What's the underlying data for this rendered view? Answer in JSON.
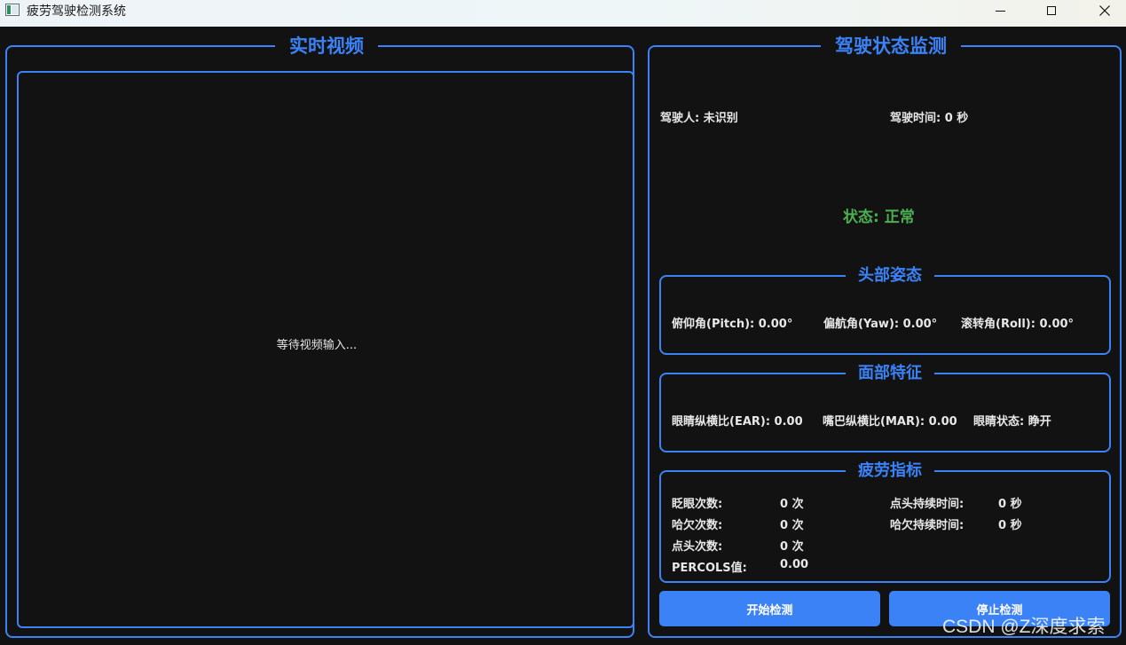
{
  "window": {
    "title": "疲劳驾驶检测系统"
  },
  "video_panel": {
    "title": "实时视频",
    "placeholder": "等待视频输入..."
  },
  "status_panel": {
    "title": "驾驶状态监测",
    "driver": "驾驶人: 未识别",
    "drive_time": "驾驶时间: 0 秒",
    "status": "状态: 正常"
  },
  "head_pose": {
    "title": "头部姿态",
    "pitch": "俯仰角(Pitch): 0.00°",
    "yaw": "偏航角(Yaw): 0.00°",
    "roll": "滚转角(Roll): 0.00°"
  },
  "face_features": {
    "title": "面部特征",
    "ear": "眼睛纵横比(EAR): 0.00",
    "mar": "嘴巴纵横比(MAR): 0.00",
    "eye_state": "眼睛状态: 睁开"
  },
  "fatigue": {
    "title": "疲劳指标",
    "blink_label": "眨眼次数:",
    "blink_value": "0 次",
    "yawn_label": "哈欠次数:",
    "yawn_value": "0 次",
    "nod_label": "点头次数:",
    "nod_value": "0 次",
    "perclos_label": "PERCOLS值:",
    "perclos_value": "0.00",
    "nod_duration_label": "点头持续时间:",
    "nod_duration_value": "0 秒",
    "yawn_duration_label": "哈欠持续时间:",
    "yawn_duration_value": "0 秒"
  },
  "buttons": {
    "start": "开始检测",
    "stop": "停止检测"
  },
  "watermark": "CSDN @Z深度求索",
  "colors": {
    "accent": "#3b82f6",
    "status_ok": "#4caf50",
    "background": "#121212"
  }
}
